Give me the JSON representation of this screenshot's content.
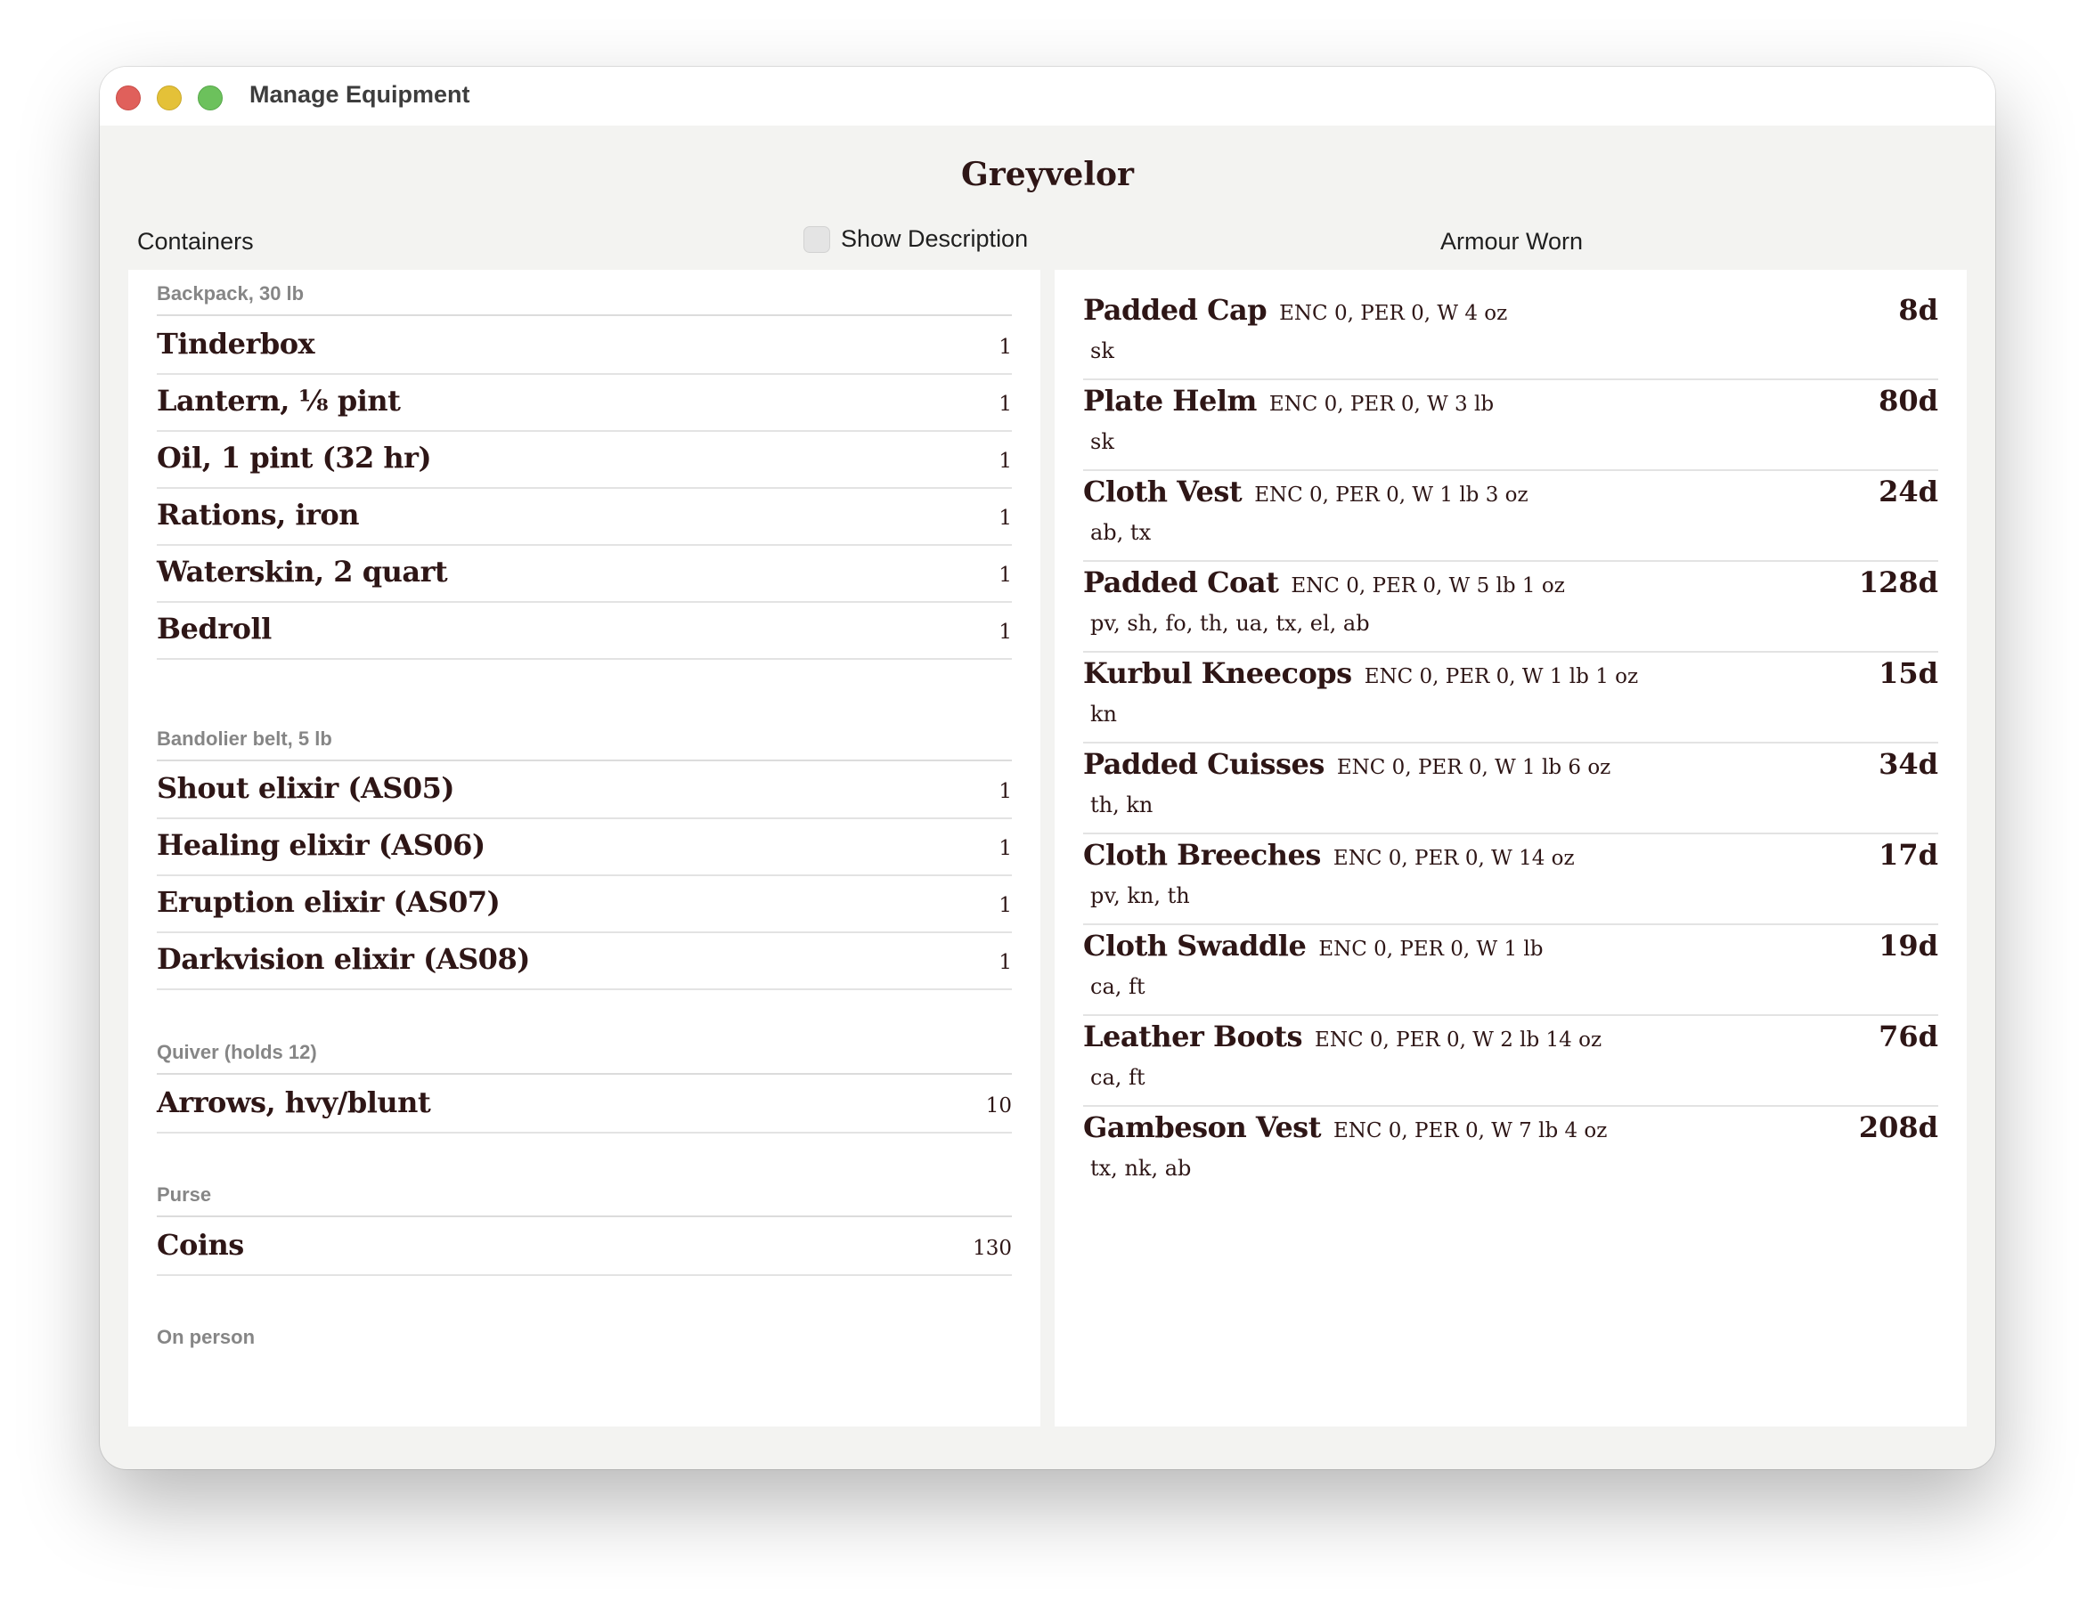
{
  "window": {
    "title": "Manage Equipment"
  },
  "character": {
    "name": "Greyvelor"
  },
  "headers": {
    "containers": "Containers",
    "show_description": "Show Description",
    "armour_worn": "Armour Worn"
  },
  "show_description_checked": false,
  "containers": [
    {
      "title": "Backpack, 30 lb",
      "items": [
        {
          "name": "Tinderbox",
          "qty": "1"
        },
        {
          "name": "Lantern, ⅛ pint",
          "qty": "1"
        },
        {
          "name": "Oil, 1 pint (32 hr)",
          "qty": "1"
        },
        {
          "name": "Rations, iron",
          "qty": "1"
        },
        {
          "name": "Waterskin, 2 quart",
          "qty": "1"
        },
        {
          "name": "Bedroll",
          "qty": "1"
        }
      ]
    },
    {
      "title": "Bandolier belt, 5 lb",
      "items": [
        {
          "name": "Shout elixir (AS05)",
          "qty": "1"
        },
        {
          "name": "Healing elixir (AS06)",
          "qty": "1"
        },
        {
          "name": "Eruption elixir (AS07)",
          "qty": "1"
        },
        {
          "name": "Darkvision elixir (AS08)",
          "qty": "1"
        }
      ]
    },
    {
      "title": "Quiver (holds 12)",
      "items": [
        {
          "name": "Arrows, hvy/blunt",
          "qty": "10"
        }
      ]
    },
    {
      "title": "Purse",
      "items": [
        {
          "name": "Coins",
          "qty": "130"
        }
      ]
    },
    {
      "title": "On person",
      "items": []
    }
  ],
  "armour": [
    {
      "name": "Padded Cap",
      "stats": "ENC 0, PER 0, W  4 oz",
      "locations": "sk",
      "cost": "8d"
    },
    {
      "name": "Plate Helm",
      "stats": "ENC 0, PER 0, W 3 lb",
      "locations": "sk",
      "cost": "80d"
    },
    {
      "name": "Cloth Vest",
      "stats": "ENC 0, PER 0, W 1 lb 3 oz",
      "locations": "ab, tx",
      "cost": "24d"
    },
    {
      "name": "Padded Coat",
      "stats": "ENC 0, PER 0, W 5 lb 1 oz",
      "locations": "pv, sh, fo, th, ua, tx, el, ab",
      "cost": "128d"
    },
    {
      "name": "Kurbul Kneecops",
      "stats": "ENC 0, PER 0, W 1 lb 1 oz",
      "locations": "kn",
      "cost": "15d"
    },
    {
      "name": "Padded Cuisses",
      "stats": "ENC 0, PER 0, W 1 lb 6 oz",
      "locations": "th, kn",
      "cost": "34d"
    },
    {
      "name": "Cloth Breeches",
      "stats": "ENC 0, PER 0, W  14 oz",
      "locations": "pv, kn, th",
      "cost": "17d"
    },
    {
      "name": "Cloth Swaddle",
      "stats": "ENC 0, PER 0, W 1 lb",
      "locations": "ca, ft",
      "cost": "19d"
    },
    {
      "name": "Leather Boots",
      "stats": "ENC 0, PER 0, W 2 lb 14 oz",
      "locations": "ca, ft",
      "cost": "76d"
    },
    {
      "name": "Gambeson Vest",
      "stats": "ENC 0, PER 0, W 7 lb 4 oz",
      "locations": "tx, nk, ab",
      "cost": "208d"
    }
  ]
}
